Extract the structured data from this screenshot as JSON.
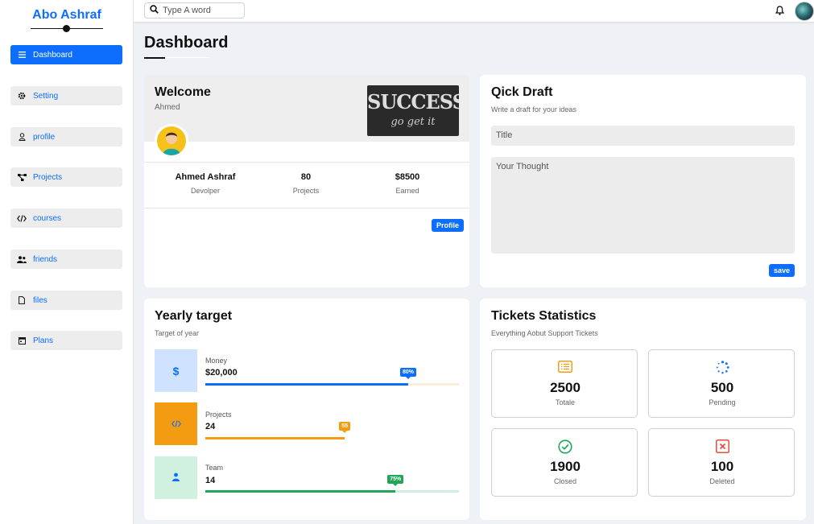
{
  "sidebar": {
    "brand": "Abo Ashraf",
    "items": [
      {
        "label": "Dashboard",
        "icon": "bars-icon"
      },
      {
        "label": "Setting",
        "icon": "gear-icon"
      },
      {
        "label": "profile",
        "icon": "user-icon"
      },
      {
        "label": "Projects",
        "icon": "diagram-icon"
      },
      {
        "label": "courses",
        "icon": "code-icon"
      },
      {
        "label": "friends",
        "icon": "users-icon"
      },
      {
        "label": "files",
        "icon": "file-icon"
      },
      {
        "label": "Plans",
        "icon": "calendar-icon"
      }
    ]
  },
  "header": {
    "search_placeholder": "Type A word"
  },
  "page": {
    "title": "Dashboard"
  },
  "welcome": {
    "title": "Welcome",
    "name": "Ahmed",
    "image_text_1": "SUCCESS",
    "image_text_2": "go get it",
    "stats": [
      {
        "value": "Ahmed Ashraf",
        "label": "Devolper"
      },
      {
        "value": "80",
        "label": "Projects"
      },
      {
        "value": "$8500",
        "label": "Earned"
      }
    ],
    "profile_button": "Profile"
  },
  "draft": {
    "title": "Qick Draft",
    "subtitle": "Write a draft for your ideas",
    "title_placeholder": "Title",
    "body_placeholder": "Your Thought",
    "save_button": "save"
  },
  "yearly": {
    "title": "Yearly target",
    "subtitle": "Target of year",
    "targets": [
      {
        "label": "Money",
        "value": "$20,000",
        "percent_label": "80%",
        "progress": 0.8,
        "icon": "dollar-icon",
        "color": "#0d6efd",
        "bg": "#cfe2ff",
        "track": "#fbeed8"
      },
      {
        "label": "Projects",
        "value": "24",
        "percent_label": "55",
        "progress": 0.55,
        "icon": "code-icon",
        "color": "#f39c12",
        "bg": "#f39c12",
        "track": "#ffffff"
      },
      {
        "label": "Team",
        "value": "14",
        "percent_label": "75%",
        "progress": 0.75,
        "icon": "user-icon",
        "color": "#22a559",
        "bg": "#d1f1e0",
        "track": "#d1f1e0"
      }
    ]
  },
  "tickets": {
    "title": "Tickets Statistics",
    "subtitle": "Everything Aobut Support Tickets",
    "items": [
      {
        "value": "2500",
        "label": "Totale",
        "icon": "list-icon",
        "color": "#f39c12"
      },
      {
        "value": "500",
        "label": "Pending",
        "icon": "spinner-icon",
        "color": "#0d6efd"
      },
      {
        "value": "1900",
        "label": "Closed",
        "icon": "check-circle-icon",
        "color": "#22a559"
      },
      {
        "value": "100",
        "label": "Deleted",
        "icon": "x-square-icon",
        "color": "#e74c3c"
      }
    ]
  }
}
